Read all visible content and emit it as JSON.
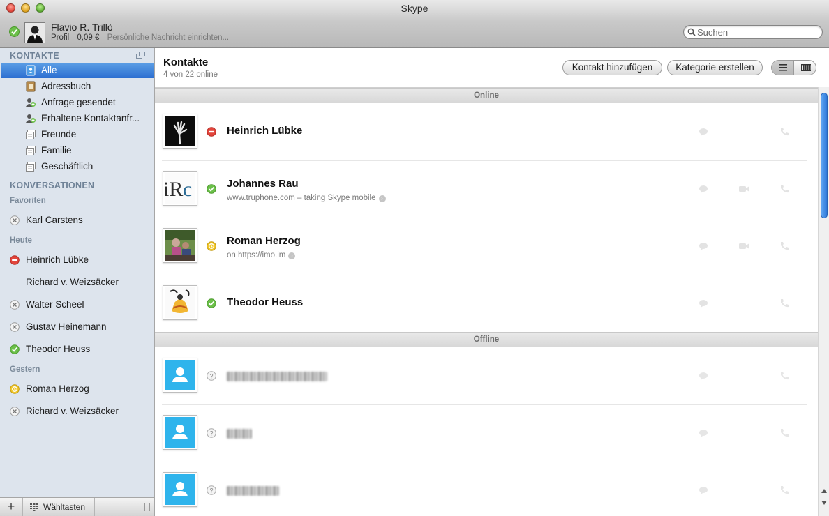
{
  "window": {
    "title": "Skype"
  },
  "profile": {
    "name": "Flavio R. Trillò",
    "profile_label": "Profil",
    "credit": "0,09 €",
    "mood_placeholder": "Persönliche Nachricht einrichten..."
  },
  "search": {
    "placeholder": "Suchen",
    "value": ""
  },
  "sidebar": {
    "contacts_header": "KONTAKTE",
    "contact_items": [
      {
        "label": "Alle",
        "icon": "contacts-book-icon",
        "selected": true
      },
      {
        "label": "Adressbuch",
        "icon": "address-book-icon"
      },
      {
        "label": "Anfrage gesendet",
        "icon": "add-contact-icon"
      },
      {
        "label": "Erhaltene Kontaktanfr...",
        "icon": "add-contact-icon"
      },
      {
        "label": "Freunde",
        "icon": "group-icon"
      },
      {
        "label": "Familie",
        "icon": "group-icon"
      },
      {
        "label": "Geschäftlich",
        "icon": "group-icon"
      }
    ],
    "conversations_header": "KONVERSATIONEN",
    "favorites_label": "Favoriten",
    "today_label": "Heute",
    "yesterday_label": "Gestern",
    "favorites": [
      {
        "name": "Karl Carstens",
        "status": "offline"
      }
    ],
    "today": [
      {
        "name": "Heinrich Lübke",
        "status": "busy"
      },
      {
        "name": "Richard v. Weizsäcker",
        "status": "none"
      },
      {
        "name": "Walter Scheel",
        "status": "offline"
      },
      {
        "name": "Gustav Heinemann",
        "status": "offline"
      },
      {
        "name": "Theodor Heuss",
        "status": "online"
      }
    ],
    "yesterday": [
      {
        "name": "Roman Herzog",
        "status": "away"
      },
      {
        "name": "Richard v. Weizsäcker",
        "status": "offline"
      }
    ],
    "bottom": {
      "add_label": "+",
      "dialpad_label": "Wähltasten"
    }
  },
  "main": {
    "title": "Kontakte",
    "subtitle": "4 von 22 online",
    "add_contact_button": "Kontakt hinzufügen",
    "create_category_button": "Kategorie erstellen",
    "online_header": "Online",
    "offline_header": "Offline",
    "online_contacts": [
      {
        "name": "Heinrich Lübke",
        "status": "busy",
        "mood": ""
      },
      {
        "name": "Johannes Rau",
        "status": "online",
        "mood": "www.truphone.com – taking Skype mobile"
      },
      {
        "name": "Roman Herzog",
        "status": "away",
        "mood": "on https://imo.im"
      },
      {
        "name": "Theodor Heuss",
        "status": "online",
        "mood": ""
      }
    ]
  },
  "colors": {
    "online": "#6cc04a",
    "busy": "#e2453c",
    "away": "#f1c72a",
    "selection": "#3d83dc",
    "sidebar_bg": "#dde4ed"
  }
}
